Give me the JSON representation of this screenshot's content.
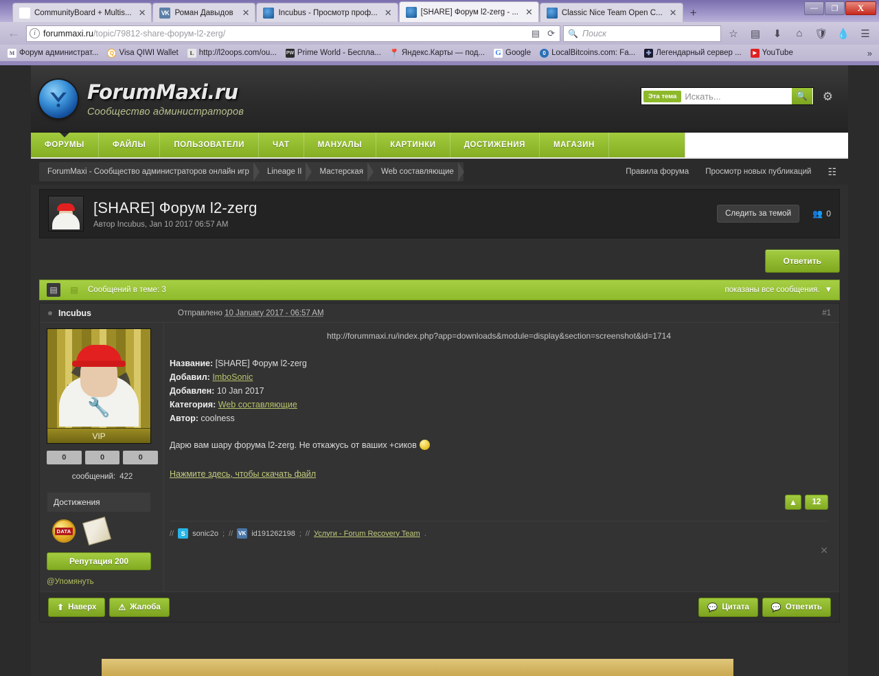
{
  "browser": {
    "tabs": [
      {
        "label": "CommunityBoard + Multis...",
        "favicon": "m-icon",
        "active": false
      },
      {
        "label": "Роман Давыдов",
        "favicon": "vk-icon",
        "active": false
      },
      {
        "label": "Incubus - Просмотр проф...",
        "favicon": "forummaxi-icon",
        "active": false
      },
      {
        "label": "[SHARE] Форум l2-zerg - ...",
        "favicon": "forummaxi-icon",
        "active": true
      },
      {
        "label": "Classic Nice Team Open C...",
        "favicon": "forummaxi-icon",
        "active": false
      }
    ],
    "newtab_label": "+",
    "window_buttons": {
      "minimize": "—",
      "maximize": "❐",
      "close": "X"
    },
    "url_host": "forummaxi.ru",
    "url_path": "/topic/79812-share-форум-l2-zerg/",
    "search_placeholder": "Поиск",
    "bookmarks": [
      {
        "label": "Форум администрат...",
        "icon": "m-icon"
      },
      {
        "label": "Visa QIWI Wallet",
        "icon": "qiwi-icon"
      },
      {
        "label": "http://l2oops.com/ou...",
        "icon": "l-icon"
      },
      {
        "label": "Prime World - Беспла...",
        "icon": "pw-icon"
      },
      {
        "label": "Яндекс.Карты — под...",
        "icon": "pin-icon"
      },
      {
        "label": "Google",
        "icon": "google-icon"
      },
      {
        "label": "LocalBitcoins.com: Fa...",
        "icon": "localbitcoins-icon"
      },
      {
        "label": "Легендарный сервер ...",
        "icon": "server-icon"
      },
      {
        "label": "YouTube",
        "icon": "youtube-icon"
      }
    ],
    "bookmarks_overflow": "»"
  },
  "site": {
    "brand_name": "ForumMaxi.ru",
    "brand_tagline": "Сообщество администраторов",
    "search_scope": "Эта тема",
    "search_placeholder": "Искать...",
    "nav": [
      {
        "label": "ФОРУМЫ",
        "active": true
      },
      {
        "label": "ФАЙЛЫ",
        "active": false
      },
      {
        "label": "ПОЛЬЗОВАТЕЛИ",
        "active": false
      },
      {
        "label": "ЧАТ",
        "active": false
      },
      {
        "label": "МАНУАЛЫ",
        "active": false
      },
      {
        "label": "КАРТИНКИ",
        "active": false
      },
      {
        "label": "ДОСТИЖЕНИЯ",
        "active": false
      },
      {
        "label": "МАГАЗИН",
        "active": false
      }
    ]
  },
  "breadcrumb": {
    "items": [
      {
        "label": "ForumMaxi - Сообщество администраторов онлайн игр"
      },
      {
        "label": "Lineage II"
      },
      {
        "label": "Мастерская"
      },
      {
        "label": "Web составляющие"
      }
    ],
    "rules_link": "Правила форума",
    "new_posts_link": "Просмотр новых публикаций"
  },
  "topic": {
    "title": "[SHARE] Форум l2-zerg",
    "meta": "Автор Incubus, Jan 10 2017 06:57 AM",
    "follow_button": "Следить за темой",
    "follow_count": "0",
    "reply_button": "Ответить",
    "posts_count_label": "Сообщений в теме: 3",
    "view_mode": "показаны все сообщения."
  },
  "post": {
    "author": "Incubus",
    "posted_prefix": "Отправлено",
    "posted_date": "10 January 2017 - 06:57 AM",
    "number": "#1",
    "screenshot_url": "http://forummaxi.ru/index.php?app=downloads&module=display&section=screenshot&id=1714",
    "fields": [
      {
        "label": "Название:",
        "value": "[SHARE] Форум l2-zerg",
        "link": false
      },
      {
        "label": "Добавил:",
        "value": "ImboSonic",
        "link": true
      },
      {
        "label": "Добавлен:",
        "value": "10 Jan 2017",
        "link": false
      },
      {
        "label": "Категория:",
        "value": "Web составляющие",
        "link": true
      },
      {
        "label": "Автор:",
        "value": "coolness",
        "link": false
      }
    ],
    "description": "Дарю вам шару форума l2-zerg. Не откажусь от ваших +сиков",
    "download_link": "Нажмите здесь, чтобы скачать файл",
    "vote_up": "▲",
    "vote_count": "12",
    "signature": {
      "skype": "sonic2o",
      "vk": "id191262198",
      "service_link": "Услуги - Forum Recovery Team",
      "sep": "//",
      "semi": ";",
      "dot": "."
    }
  },
  "profile": {
    "rank": "VIP",
    "stats": [
      "0",
      "0",
      "0"
    ],
    "messages_label": "сообщений:",
    "messages_value": "422",
    "achievements_title": "Достижения",
    "achievement_badge": "DATA",
    "reputation": "Репутация 200",
    "mention": "@Упомянуть"
  },
  "footer": {
    "top_button": "Наверх",
    "report_button": "Жалоба",
    "quote_button": "Цитата",
    "reply_button": "Ответить"
  },
  "colors": {
    "accent_green": "#8fbb2c",
    "dark_bg": "#2b2b2b",
    "post_bg": "#333333",
    "link_olive": "#c3cd7d"
  }
}
